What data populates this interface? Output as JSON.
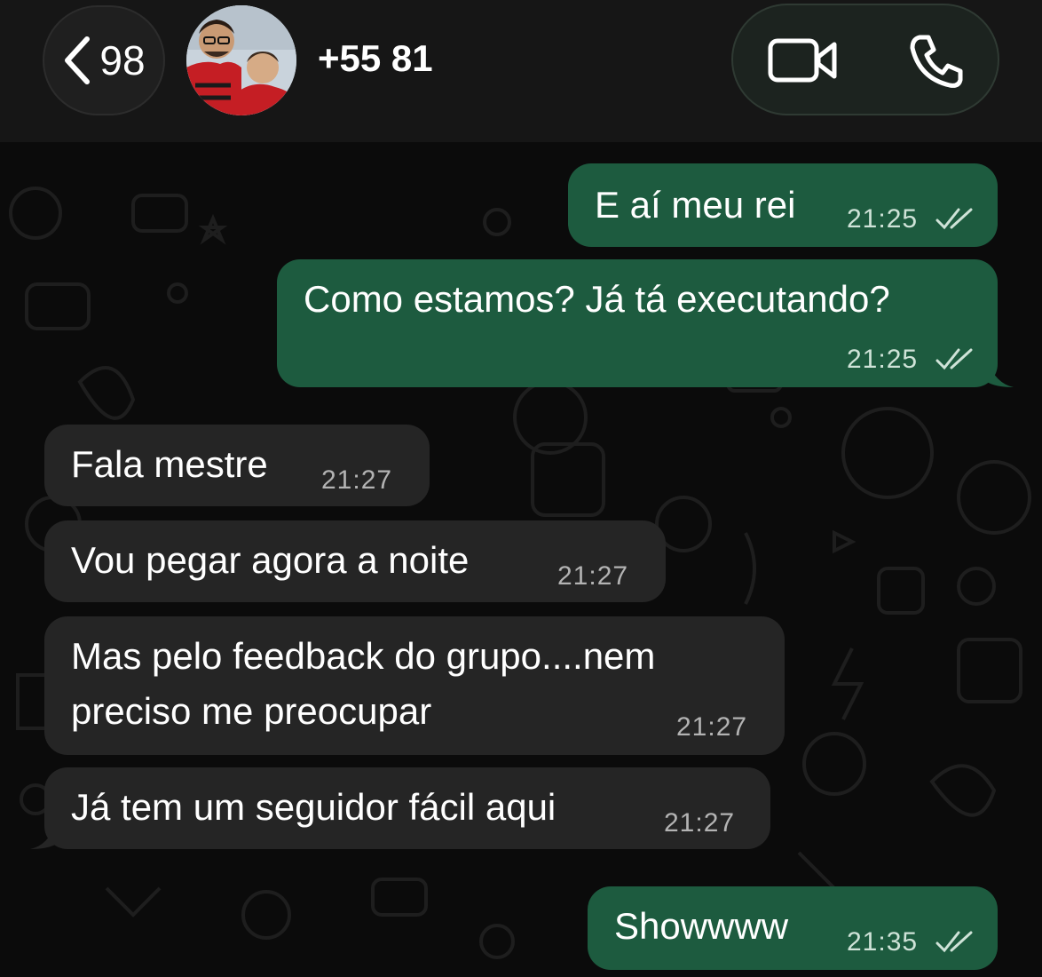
{
  "header": {
    "back_count": "98",
    "contact_name": "+55 81",
    "icons": {
      "back": "chevron-left-icon",
      "video": "video-camera-icon",
      "phone": "phone-icon",
      "avatar": "contact-avatar"
    }
  },
  "colors": {
    "background": "#0b0b0b",
    "header": "#161616",
    "outgoing_bubble": "#1d5b3f",
    "incoming_bubble": "#252525",
    "read_ticks": "#cfe3d8"
  },
  "messages": [
    {
      "direction": "outgoing",
      "text": "E aí meu rei",
      "time": "21:25",
      "status": "read"
    },
    {
      "direction": "outgoing",
      "text": "Como estamos? Já tá executando?",
      "time": "21:25",
      "status": "read"
    },
    {
      "direction": "incoming",
      "text": "Fala mestre",
      "time": "21:27"
    },
    {
      "direction": "incoming",
      "text": "Vou pegar agora a noite",
      "time": "21:27"
    },
    {
      "direction": "incoming",
      "text_line1": "Mas pelo feedback do grupo....nem",
      "text_line2": "preciso me preocupar",
      "time": "21:27"
    },
    {
      "direction": "incoming",
      "text": "Já tem um seguidor fácil aqui",
      "time": "21:27"
    },
    {
      "direction": "outgoing",
      "text": "Showwww",
      "time": "21:35",
      "status": "read"
    }
  ]
}
